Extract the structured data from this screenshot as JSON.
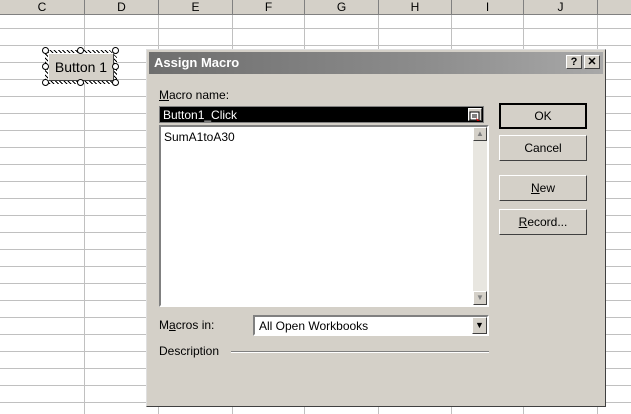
{
  "spreadsheet": {
    "columns": [
      "C",
      "D",
      "E",
      "F",
      "G",
      "H",
      "I",
      "J"
    ],
    "partial_column": "",
    "form_button_label": "Button 1"
  },
  "dialog": {
    "title": "Assign Macro",
    "help_glyph": "?",
    "close_glyph": "✕",
    "macro_name_label": {
      "access_key": "M",
      "rest": "acro name:"
    },
    "macro_name_value": "Button1_Click",
    "macro_list": [
      "SumA1toA30"
    ],
    "buttons": {
      "ok": "OK",
      "cancel": "Cancel",
      "new": {
        "access_key": "N",
        "rest": "ew"
      },
      "record": {
        "access_key": "R",
        "rest": "ecord..."
      }
    },
    "macros_in_label": {
      "pre": "M",
      "access_key": "a",
      "rest": "cros in:"
    },
    "macros_in_value": "All Open Workbooks",
    "description_label": "Description"
  }
}
